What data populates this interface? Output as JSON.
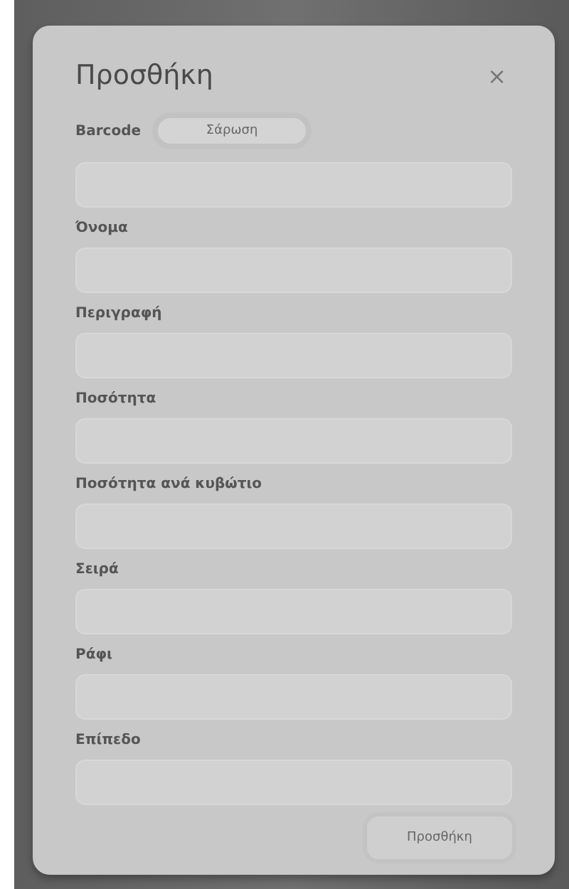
{
  "dialog": {
    "title": "Προσθήκη",
    "close": "×"
  },
  "barcode": {
    "label": "Barcode",
    "scan_button": "Σάρωση"
  },
  "fields": [
    {
      "label": "Όνομα"
    },
    {
      "label": "Περιγραφή"
    },
    {
      "label": "Ποσότητα"
    },
    {
      "label": "Ποσότητα ανά κυβώτιο"
    },
    {
      "label": "Σειρά"
    },
    {
      "label": "Ράφι"
    },
    {
      "label": "Επίπεδο"
    }
  ],
  "submit_button": "Προσθήκη"
}
